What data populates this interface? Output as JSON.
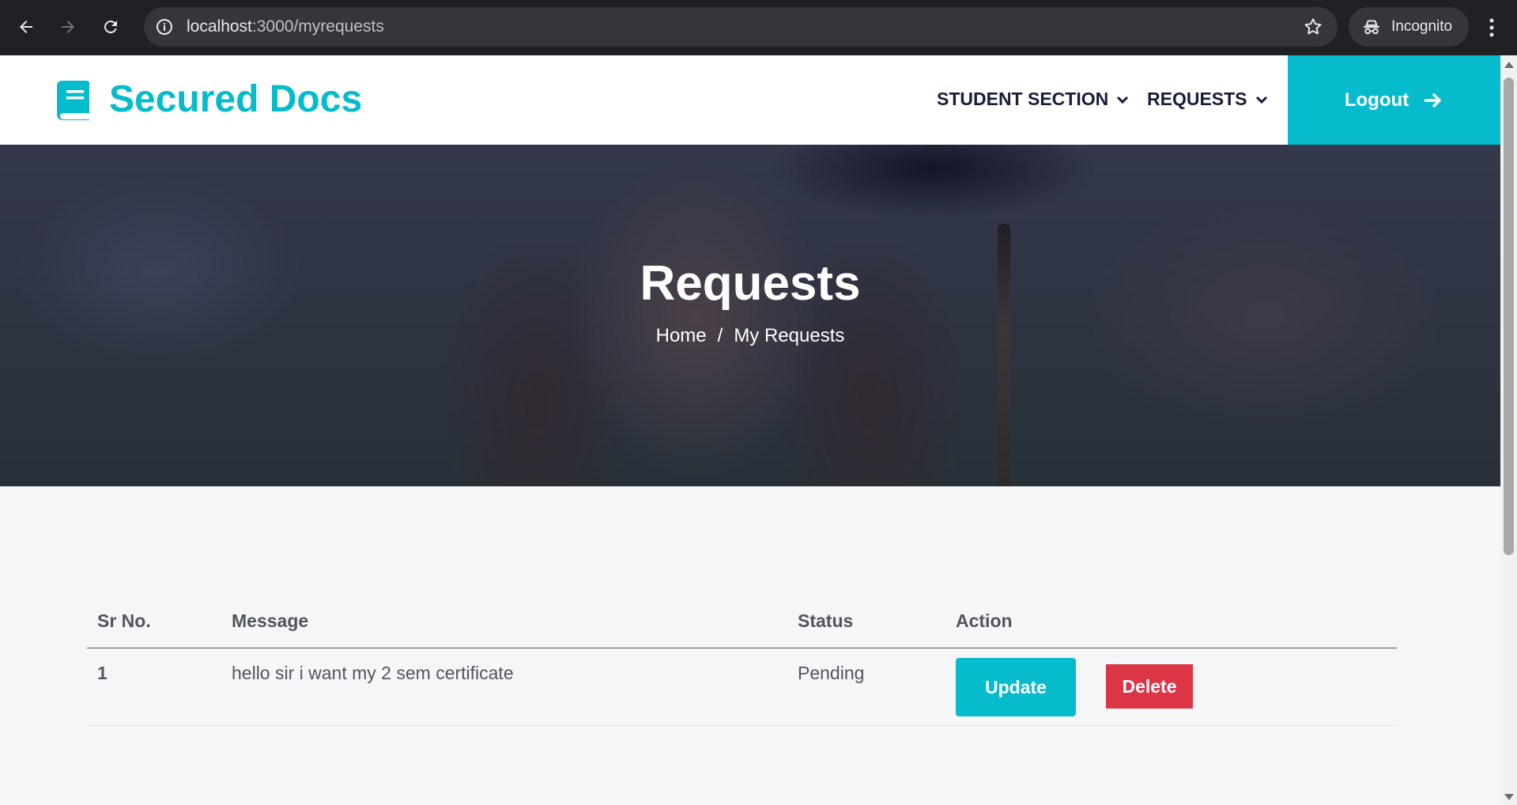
{
  "browser": {
    "url_host": "localhost",
    "url_path": ":3000/myrequests",
    "profile_label": "Incognito",
    "icons": [
      "back-icon",
      "forward-icon",
      "reload-icon",
      "site-info-icon",
      "bookmark-star-icon",
      "incognito-icon",
      "menu-kebab-icon"
    ]
  },
  "navbar": {
    "brand": "Secured Docs",
    "brand_icon": "book-icon",
    "items": [
      {
        "label": "STUDENT SECTION",
        "icon": "chevron-down-icon"
      },
      {
        "label": "REQUESTS",
        "icon": "chevron-down-icon"
      }
    ],
    "logout_label": "Logout",
    "logout_icon": "arrow-right-icon"
  },
  "hero": {
    "title": "Requests",
    "breadcrumb": {
      "home": "Home",
      "separator": "/",
      "current": "My Requests"
    }
  },
  "table": {
    "headers": [
      "Sr No.",
      "Message",
      "Status",
      "Action"
    ],
    "rows": [
      {
        "sr": "1",
        "message": "hello sir i want my 2 sem certificate",
        "status": "Pending",
        "update_label": "Update",
        "delete_label": "Delete"
      }
    ]
  },
  "colors": {
    "primary": "#06bbcc",
    "danger": "#dc3545",
    "dark": "#181d38",
    "chrome": "#202124"
  }
}
